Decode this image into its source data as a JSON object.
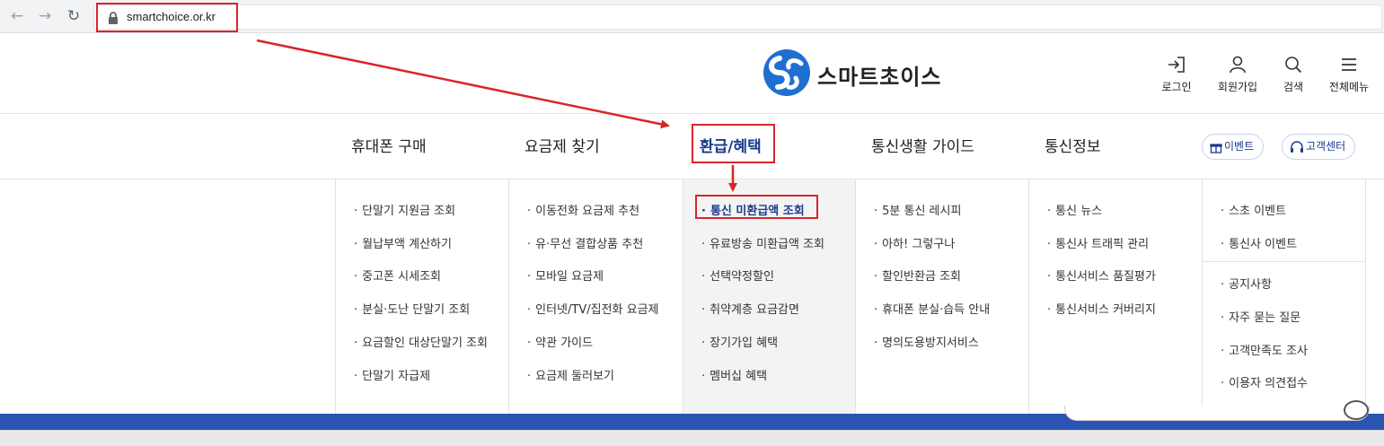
{
  "browser": {
    "url": "smartchoice.or.kr",
    "back_icon": "←",
    "forward_icon": "→",
    "reload_icon": "↻"
  },
  "header": {
    "logo_text": "스마트초이스",
    "utilities": [
      {
        "label": "로그인",
        "icon": "login-icon"
      },
      {
        "label": "회원가입",
        "icon": "user-icon"
      },
      {
        "label": "검색",
        "icon": "search-icon"
      },
      {
        "label": "전체메뉴",
        "icon": "menu-icon"
      }
    ]
  },
  "gnb": {
    "items": [
      "휴대폰 구매",
      "요금제 찾기",
      "환급/혜택",
      "통신생활 가이드",
      "통신정보"
    ],
    "active_index": 2,
    "event_label": "이벤트",
    "support_label": "고객센터"
  },
  "mega_menu": {
    "columns": [
      {
        "items": [
          "단말기 지원금 조회",
          "월납부액 계산하기",
          "중고폰 시세조회",
          "분실·도난 단말기 조회",
          "요금할인 대상단말기 조회",
          "단말기 자급제"
        ]
      },
      {
        "items": [
          "이동전화 요금제 추천",
          "유·무선 결합상품 추천",
          "모바일 요금제",
          "인터넷/TV/집전화 요금제",
          "약관 가이드",
          "요금제 둘러보기"
        ]
      },
      {
        "items": [
          "통신 미환급액 조회",
          "유료방송 미환급액 조회",
          "선택약정할인",
          "취약계층 요금감면",
          "장기가입 혜택",
          "멤버십 혜택"
        ]
      },
      {
        "items": [
          "5분 통신 레시피",
          "아하! 그렇구나",
          "할인반환금 조회",
          "휴대폰 분실·습득 안내",
          "명의도용방지서비스"
        ]
      },
      {
        "items": [
          "통신 뉴스",
          "통신사 트래픽 관리",
          "통신서비스 품질평가",
          "통신서비스 커버리지"
        ]
      },
      {
        "items": [
          "스초 이벤트",
          "통신사 이벤트",
          "공지사항",
          "자주 묻는 질문",
          "고객만족도 조사",
          "이용자 의견접수"
        ]
      }
    ],
    "active_item": "통신 미환급액 조회"
  },
  "colors": {
    "brand_blue": "#1a3b8c",
    "band_blue": "#2b54b3",
    "annotation_red": "#d7262b"
  }
}
